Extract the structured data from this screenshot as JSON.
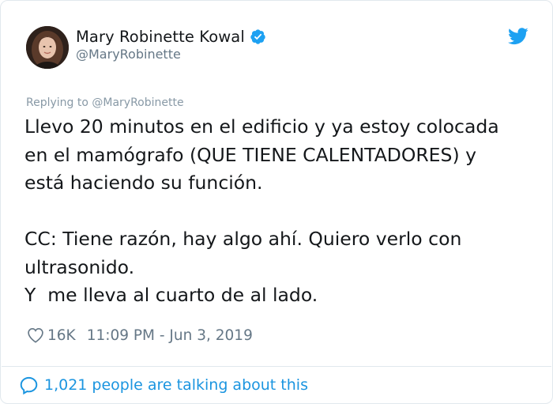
{
  "author": {
    "display_name": "Mary Robinette Kowal",
    "handle": "@MaryRobinette",
    "verified": true,
    "avatar_icon": "avatar-photo"
  },
  "reply": {
    "label": "Replying to @MaryRobinette"
  },
  "tweet": {
    "text": "Llevo 20 minutos en el edificio y ya estoy colocada\nen el mamógrafo (QUE TIENE CALENTADORES) y\nestá haciendo su función.\n\nCC: Tiene razón, hay algo ahí. Quiero verlo con\nultrasonido.\nY  me lleva al cuarto de al lado."
  },
  "meta": {
    "likes": "16K",
    "timestamp": "11:09 PM - Jun 3, 2019"
  },
  "footer": {
    "conversation": "1,021 people are talking about this"
  },
  "icons": {
    "verified": "verified-badge-icon",
    "brand": "twitter-bird-icon",
    "like": "heart-icon",
    "conversation": "speech-bubble-icon"
  },
  "colors": {
    "brand_blue": "#1da1f2",
    "link_blue": "#1b95e0",
    "muted": "#657786",
    "text": "#14171a",
    "border": "#e1e8ed"
  }
}
